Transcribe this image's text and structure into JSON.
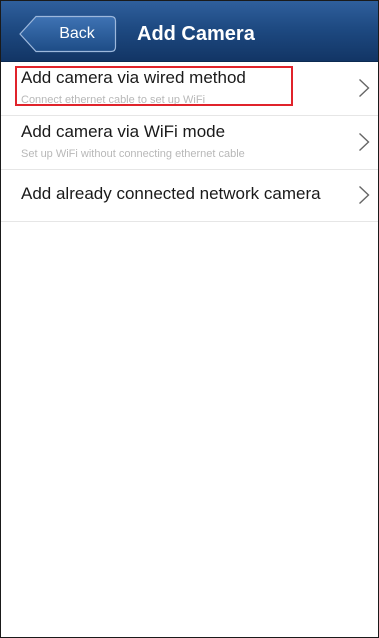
{
  "header": {
    "back_label": "Back",
    "title": "Add Camera"
  },
  "menu": {
    "items": [
      {
        "title": "Add camera via wired method",
        "subtitle": "Connect ethernet cable to set up WiFi",
        "icon": "chevron-right-icon"
      },
      {
        "title": "Add camera via WiFi mode",
        "subtitle": "Set up WiFi without connecting ethernet cable",
        "icon": "chevron-right-icon"
      },
      {
        "title": "Add already connected network camera",
        "subtitle": "",
        "icon": "chevron-right-icon"
      }
    ]
  },
  "colors": {
    "header_top": "#2f5f9c",
    "header_bottom": "#123565",
    "highlight": "#e0232b",
    "subtitle": "#b8b8b8"
  }
}
